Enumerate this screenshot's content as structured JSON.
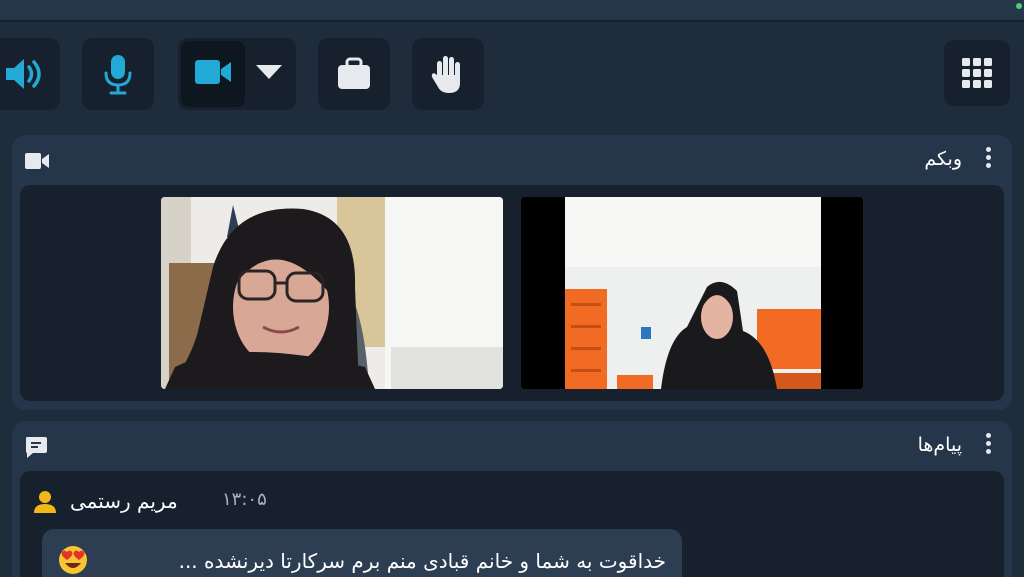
{
  "colors": {
    "background": "#1f2c3c",
    "panel": "#26364a",
    "panel_inner": "#17212e",
    "accent": "#22a9d6",
    "icon_light": "#e6e9ee"
  },
  "toolbar": {
    "buttons": [
      {
        "icon": "speaker-icon"
      },
      {
        "icon": "microphone-icon"
      },
      {
        "icon": "video-camera-icon"
      },
      {
        "icon": "chevron-down-icon"
      },
      {
        "icon": "share-screen-icon"
      },
      {
        "icon": "raise-hand-icon"
      },
      {
        "icon": "apps-grid-icon"
      }
    ]
  },
  "webcam_panel": {
    "title": "وبکم",
    "icon": "video-camera-icon"
  },
  "messages_panel": {
    "title": "پیام‌ها",
    "icon": "chat-icon",
    "messages": [
      {
        "sender": "مریم رستمی",
        "time": "۱۳:۰۵",
        "text": "خداقوت به شما و خانم قبادی منم برم سرکارتا دیرنشده ...",
        "emoji": "heart-eyes-emoji"
      }
    ]
  }
}
